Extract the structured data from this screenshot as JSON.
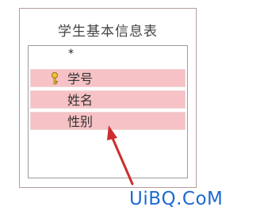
{
  "table": {
    "title": "学生基本信息表",
    "asterisk": "*",
    "fields": [
      {
        "label": "学号",
        "primary_key": true,
        "selected": true
      },
      {
        "label": "姓名",
        "primary_key": false,
        "selected": true
      },
      {
        "label": "性别",
        "primary_key": false,
        "selected": true
      }
    ]
  },
  "watermark": {
    "text": "UiBQ.CoM"
  },
  "colors": {
    "selection": "#f6c2c5",
    "arrow": "#cc2e2e",
    "watermark": "#1e6ad1",
    "window_border": "#b89b9b"
  },
  "icons": {
    "key": "key-icon"
  }
}
